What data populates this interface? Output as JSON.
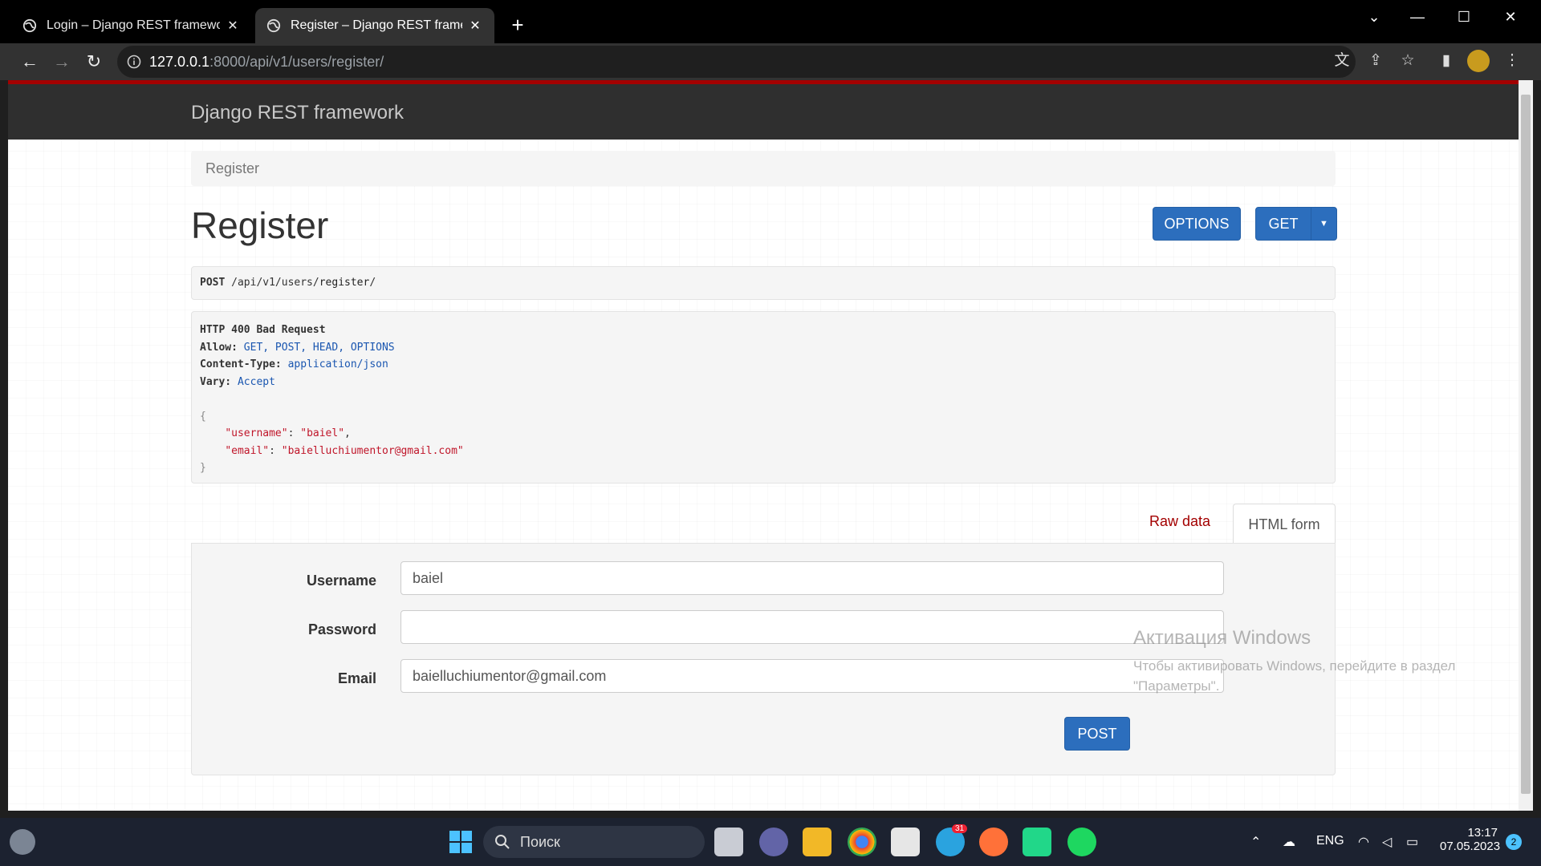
{
  "browser": {
    "tabs": [
      {
        "title": "Login – Django REST framework"
      },
      {
        "title": "Register – Django REST framework"
      }
    ],
    "new_tab": "+",
    "window_controls": {
      "minimize": "—",
      "maximize": "☐",
      "close": "✕",
      "tab_search": "⌄"
    },
    "url_host": "127.0.0.1",
    "url_rest": ":8000/api/v1/users/register/"
  },
  "app": {
    "brand": "Django REST framework",
    "breadcrumb": "Register",
    "title": "Register",
    "buttons": {
      "options": "OPTIONS",
      "get": "GET",
      "caret": "▼",
      "post": "POST"
    },
    "request": {
      "method": "POST",
      "path_prefix": "/api/v1/users/",
      "path_last": "register",
      "path_suffix": "/"
    },
    "response": {
      "status": "HTTP 400 Bad Request",
      "allow_key": "Allow:",
      "allow_val": "GET, POST, HEAD, OPTIONS",
      "ctype_key": "Content-Type:",
      "ctype_val": "application/json",
      "vary_key": "Vary:",
      "vary_val": "Accept",
      "open_brace": "{",
      "username_key": "\"username\"",
      "username_val": "\"baiel\"",
      "email_key": "\"email\"",
      "email_val": "\"baielluchiumentor@gmail.com\"",
      "close_brace": "}"
    },
    "form_tabs": {
      "raw": "Raw data",
      "html": "HTML form"
    },
    "form": {
      "username_label": "Username",
      "username_value": "baiel",
      "password_label": "Password",
      "password_value": "",
      "email_label": "Email",
      "email_value": "baielluchiumentor@gmail.com"
    }
  },
  "watermark": {
    "line1": "Активация Windows",
    "line2": "Чтобы активировать Windows, перейдите в раздел",
    "line3": "\"Параметры\"."
  },
  "taskbar": {
    "search": "Поиск",
    "lang": "ENG",
    "time": "13:17",
    "date": "07.05.2023",
    "notif_count": "2",
    "telegram_badge": "31"
  },
  "colors": {
    "accent": "#2c6ebd",
    "navbar": "#2f2f2f",
    "navbar_border": "#a30000",
    "link": "#a30000"
  }
}
